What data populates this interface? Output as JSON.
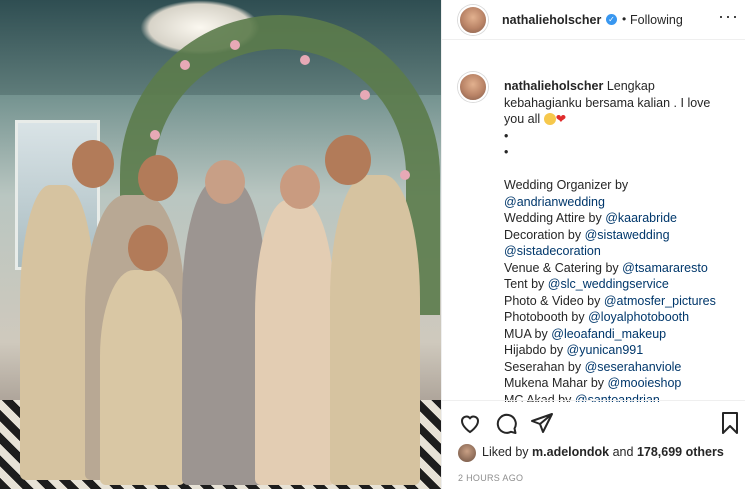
{
  "post": {
    "username": "nathalieholscher",
    "separator_dot": "•",
    "follow_status": "Following",
    "more_icon": "more-dots-icon"
  },
  "caption": {
    "username": "nathalieholscher",
    "text_line1": "Lengkap",
    "text_line2": "kebahagianku bersama kalian . I love",
    "text_line3": "you all",
    "bullet1": "•",
    "bullet2": "•",
    "credits": [
      {
        "label": "Wedding Organizer by",
        "link": ""
      },
      {
        "label": "",
        "link": "@andrianwedding"
      },
      {
        "label": "Wedding Attire by ",
        "link": "@kaarabride"
      },
      {
        "label": "Decoration by ",
        "link": "@sistawedding"
      },
      {
        "label": "",
        "link": "@sistadecoration"
      },
      {
        "label": "Venue & Catering by ",
        "link": "@tsamararesto"
      },
      {
        "label": "Tent by ",
        "link": "@slc_weddingservice"
      },
      {
        "label": "Photo & Video by ",
        "link": "@atmosfer_pictures"
      },
      {
        "label": "Photobooth by ",
        "link": "@loyalphotobooth"
      },
      {
        "label": "MUA by ",
        "link": "@leoafandi_makeup"
      },
      {
        "label": "Hijabdo by ",
        "link": "@yunican991"
      },
      {
        "label": "Seserahan by ",
        "link": "@seserahanviole"
      },
      {
        "label": "Mukena Mahar by ",
        "link": "@mooieshop"
      },
      {
        "label": "MC Akad by ",
        "link": "@santoandrian"
      }
    ]
  },
  "engagement": {
    "liked_prefix": "Liked by ",
    "liked_user": "m.adelondok",
    "liked_and": " and ",
    "liked_count": "178,699 others",
    "timestamp": "2 HOURS AGO",
    "icons": [
      "heart-icon",
      "comment-icon",
      "share-icon",
      "bookmark-icon"
    ]
  },
  "colors": {
    "link": "#00376b",
    "verified": "#3897f0",
    "muted": "#8e8e8e"
  }
}
